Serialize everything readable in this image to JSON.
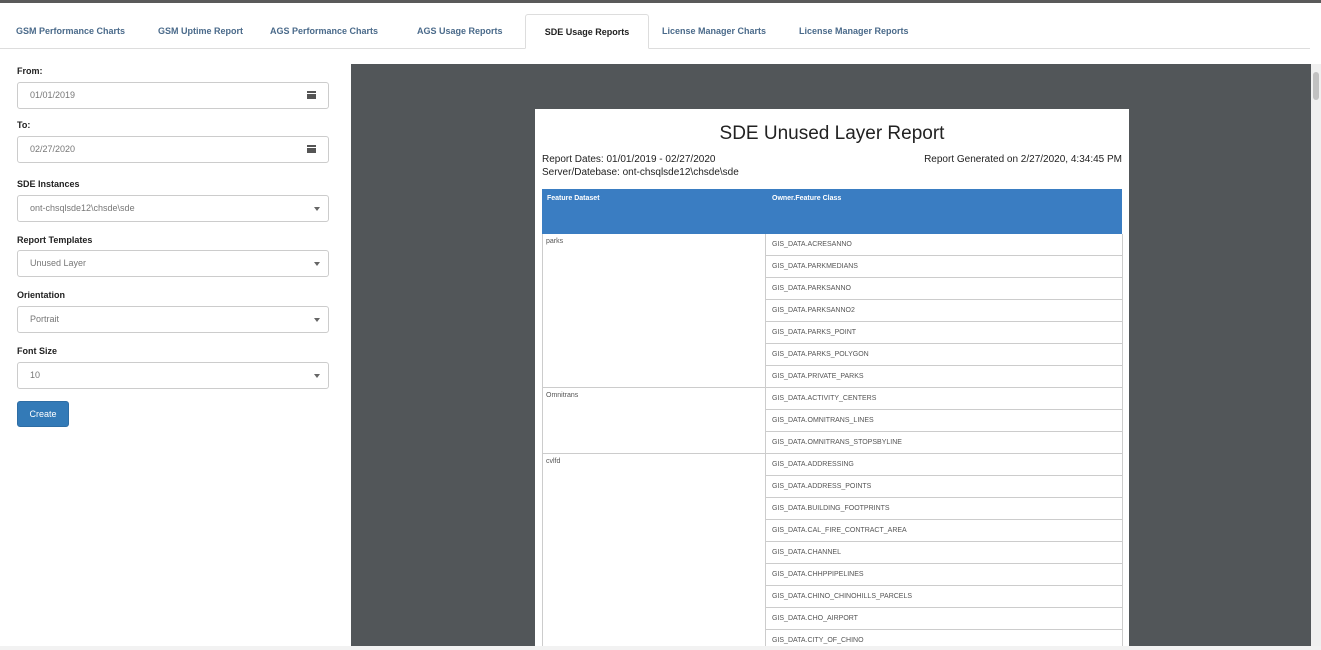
{
  "tabs": [
    {
      "label": "GSM Performance Charts"
    },
    {
      "label": "GSM Uptime Report"
    },
    {
      "label": "AGS Performance Charts"
    },
    {
      "label": "AGS Usage Reports"
    },
    {
      "label": "SDE Usage Reports",
      "active": true
    },
    {
      "label": "License Manager Charts"
    },
    {
      "label": "License Manager Reports"
    }
  ],
  "form": {
    "from_label": "From:",
    "from_value": "01/01/2019",
    "to_label": "To:",
    "to_value": "02/27/2020",
    "instances_label": "SDE Instances",
    "instances_value": "ont-chsqlsde12\\chsde\\sde",
    "templates_label": "Report Templates",
    "templates_value": "Unused Layer",
    "orientation_label": "Orientation",
    "orientation_value": "Portrait",
    "fontsize_label": "Font Size",
    "fontsize_value": "10",
    "create_label": "Create"
  },
  "report": {
    "title": "SDE Unused Layer Report",
    "dates": "Report Dates: 01/01/2019 - 02/27/2020",
    "generated": "Report Generated on 2/27/2020, 4:34:45 PM",
    "server": "Server/Datebase: ont-chsqlsde12\\chsde\\sde",
    "col1": "Feature Dataset",
    "col2": "Owner.Feature Class",
    "datasets": [
      {
        "name": "parks"
      },
      {
        "name": "Omnitrans"
      },
      {
        "name": "cvlfd"
      }
    ],
    "classes": [
      "GIS_DATA.ACRESANNO",
      "GIS_DATA.PARKMEDIANS",
      "GIS_DATA.PARKSANNO",
      "GIS_DATA.PARKSANNO2",
      "GIS_DATA.PARKS_POINT",
      "GIS_DATA.PARKS_POLYGON",
      "GIS_DATA.PRIVATE_PARKS",
      "GIS_DATA.ACTIVITY_CENTERS",
      "GIS_DATA.OMNITRANS_LINES",
      "GIS_DATA.OMNITRANS_STOPSBYLINE",
      "GIS_DATA.ADDRESSING",
      "GIS_DATA.ADDRESS_POINTS",
      "GIS_DATA.BUILDING_FOOTPRINTS",
      "GIS_DATA.CAL_FIRE_CONTRACT_AREA",
      "GIS_DATA.CHANNEL",
      "GIS_DATA.CHHPPIPELINES",
      "GIS_DATA.CHINO_CHINOHILLS_PARCELS",
      "GIS_DATA.CHO_AIRPORT",
      "GIS_DATA.CITY_OF_CHINO"
    ]
  }
}
